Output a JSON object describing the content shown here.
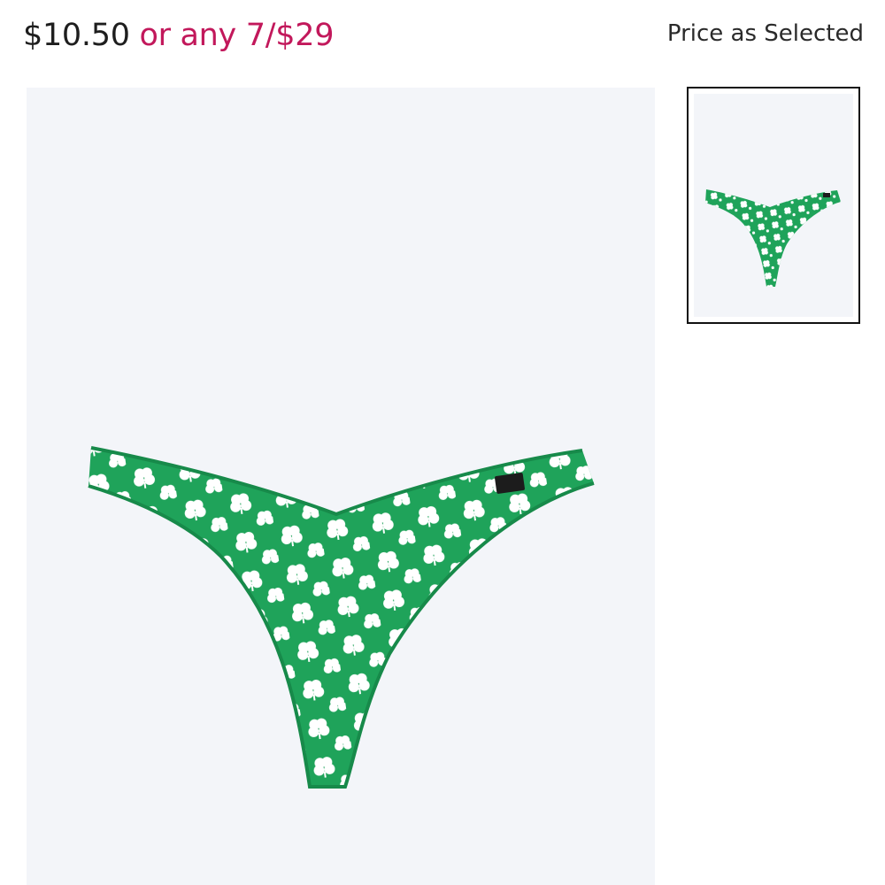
{
  "price": {
    "amount": "$10.50",
    "promo": "or any 7/$29",
    "note": "Price as Selected"
  },
  "product_image": {
    "subject": "green thong with white shamrock print",
    "icon": "product-photo"
  },
  "thumbnails": [
    {
      "subject": "green thong with white shamrock print",
      "selected": true
    }
  ],
  "colors": {
    "promo": "#c2185b",
    "fabric": "#1fa35a",
    "image_bg": "#f3f5f9",
    "thumb_border": "#111111"
  }
}
